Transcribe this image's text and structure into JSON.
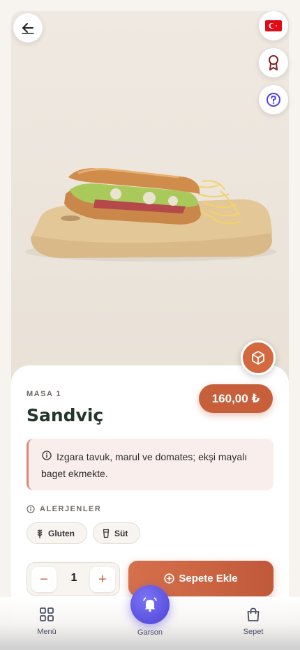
{
  "header": {
    "back_icon": "arrow-left-icon",
    "language_flag": "turkey-flag-icon",
    "award_icon": "award-ribbon-icon",
    "help_icon": "question-circle-icon",
    "ar_icon": "cube-3d-icon"
  },
  "product": {
    "table": "MASA 1",
    "name": "Sandviç",
    "price": "160,00 ₺",
    "description": "Izgara tavuk, marul ve domates; ekşi mayalı baget ekmekte."
  },
  "allergens": {
    "title": "ALERJENLER",
    "items": [
      {
        "label": "Gluten",
        "icon": "wheat-icon"
      },
      {
        "label": "Süt",
        "icon": "milk-glass-icon"
      }
    ]
  },
  "order": {
    "quantity": "1",
    "minus_label": "−",
    "plus_label": "+",
    "add_label": "Sepete Ekle"
  },
  "nav": {
    "menu_label": "Menü",
    "waiter_label": "Garson",
    "cart_label": "Sepet"
  },
  "colors": {
    "accent": "#c65f3a",
    "title": "#23362a",
    "waiter": "#5b52e6"
  }
}
